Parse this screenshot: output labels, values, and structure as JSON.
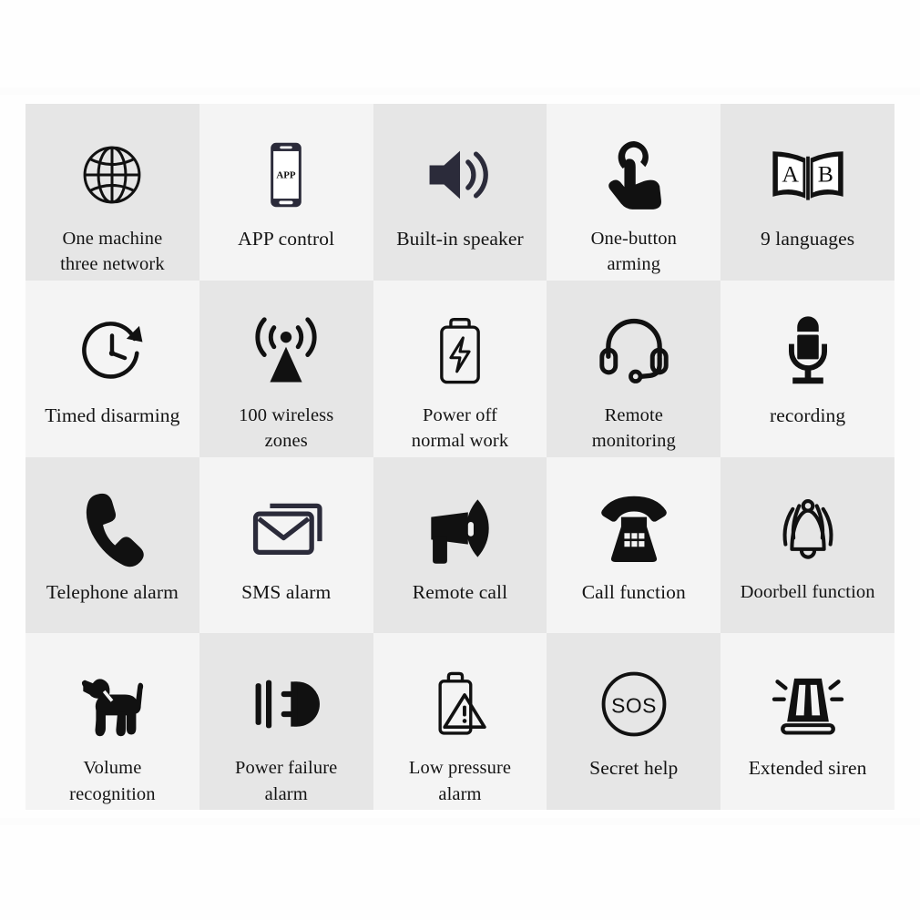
{
  "page": {
    "title": "Alarm System Feature Grid",
    "background_color": "#fefefe",
    "cell_shade_dark": "#e6e6e6",
    "cell_shade_light": "#f4f4f4",
    "icon_color": "#111111",
    "icon_color_navy": "#2b2b3a",
    "text_color": "#141414",
    "columns": 5,
    "rows": 4
  },
  "features": [
    {
      "icon": "globe-icon",
      "label": "One machine\nthree network"
    },
    {
      "icon": "smartphone-app-icon",
      "label": "APP control"
    },
    {
      "icon": "speaker-icon",
      "label": "Built-in speaker"
    },
    {
      "icon": "touch-finger-icon",
      "label": "One-button\narming"
    },
    {
      "icon": "open-book-ab-icon",
      "label": "9 languages"
    },
    {
      "icon": "clock-rotate-icon",
      "label": "Timed disarming"
    },
    {
      "icon": "antenna-signal-icon",
      "label": "100 wireless\nzones"
    },
    {
      "icon": "battery-bolt-icon",
      "label": "Power off\nnormal work"
    },
    {
      "icon": "headset-icon",
      "label": "Remote\nmonitoring"
    },
    {
      "icon": "microphone-icon",
      "label": "recording"
    },
    {
      "icon": "phone-handset-icon",
      "label": "Telephone alarm"
    },
    {
      "icon": "envelope-stack-icon",
      "label": "SMS alarm"
    },
    {
      "icon": "megaphone-icon",
      "label": "Remote call"
    },
    {
      "icon": "desk-phone-icon",
      "label": "Call function"
    },
    {
      "icon": "ringing-bell-icon",
      "label": "Doorbell function"
    },
    {
      "icon": "dog-icon",
      "label": "Volume\nrecognition"
    },
    {
      "icon": "unplugged-plug-icon",
      "label": "Power failure\nalarm"
    },
    {
      "icon": "battery-warning-icon",
      "label": "Low pressure\nalarm"
    },
    {
      "icon": "sos-circle-icon",
      "label": "Secret help"
    },
    {
      "icon": "siren-light-icon",
      "label": "Extended siren"
    }
  ],
  "icon_text": {
    "app_screen": "APP",
    "book_left_page": "A",
    "book_right_page": "B",
    "sos": "SOS"
  }
}
